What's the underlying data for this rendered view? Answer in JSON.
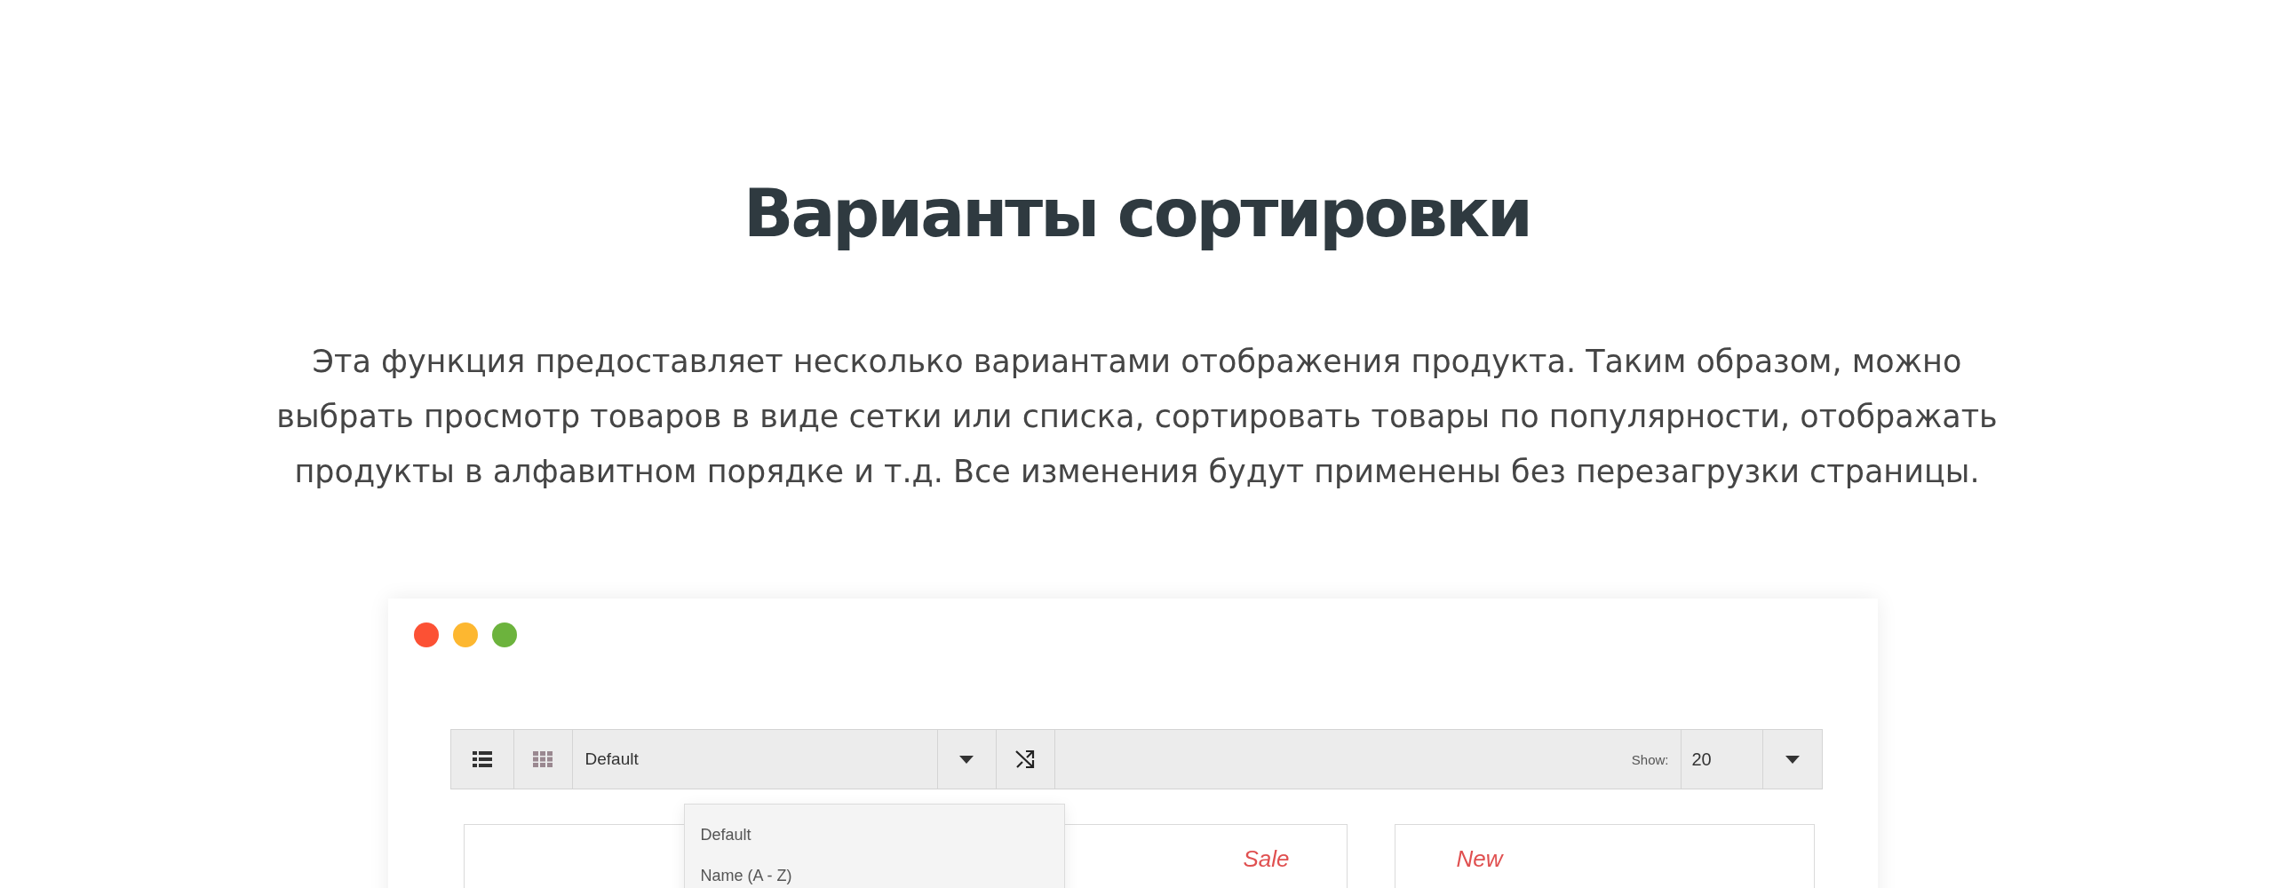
{
  "heading": "Варианты сортировки",
  "description": "Эта функция предоставляет несколько вариантами отображения продукта. Таким образом, можно выбрать просмотр товаров в виде сетки или списка, сортировать товары по популярности, отображать продукты в алфавитном порядке и т.д. Все изменения будут применены без перезагрузки страницы.",
  "window": {
    "toolbar": {
      "view_buttons": [
        {
          "kind": "list",
          "selected": true
        },
        {
          "kind": "grid",
          "selected": false
        }
      ],
      "sort_value": "Default",
      "show_label": "Show:",
      "show_value": "20"
    },
    "sort_menu": {
      "options": [
        "Default",
        "Name (A - Z)"
      ]
    },
    "products": [
      {
        "badge": "Sale"
      },
      {
        "badge": "New"
      }
    ]
  }
}
